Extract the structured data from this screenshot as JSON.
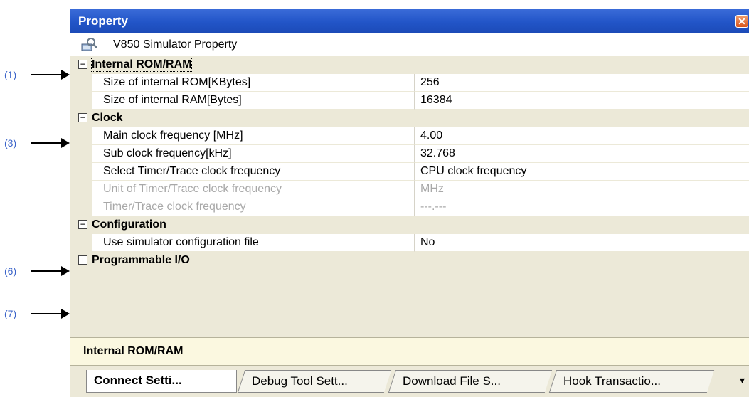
{
  "callouts": [
    "(1)",
    "(3)",
    "(6)",
    "(7)"
  ],
  "window": {
    "title": "Property",
    "close_icon": "close-icon"
  },
  "header": {
    "icon": "simulator-property-icon",
    "name": "V850 Simulator Property"
  },
  "grid": {
    "categories": [
      {
        "toggle": "−",
        "name": "Internal ROM/RAM"
      },
      {
        "toggle": "−",
        "name": "Clock"
      },
      {
        "toggle": "−",
        "name": "Configuration"
      },
      {
        "toggle": "+",
        "name": "Programmable I/O"
      }
    ],
    "rows": [
      {
        "key": "Size of internal ROM[KBytes]",
        "value": "256"
      },
      {
        "key": "Size of internal RAM[Bytes]",
        "value": "16384"
      },
      {
        "key": "Main clock frequency [MHz]",
        "value": "4.00"
      },
      {
        "key": "Sub clock frequency[kHz]",
        "value": "32.768"
      },
      {
        "key": "Select Timer/Trace clock frequency",
        "value": "CPU clock frequency"
      },
      {
        "key": "Unit of Timer/Trace clock frequency",
        "value": "MHz"
      },
      {
        "key": "Timer/Trace clock frequency",
        "value": "---.---"
      },
      {
        "key": "Use simulator configuration file",
        "value": "No"
      }
    ]
  },
  "description": "Internal ROM/RAM",
  "tabs": [
    "Connect Setti...",
    "Debug Tool Sett...",
    "Download File S...",
    "Hook Transactio..."
  ],
  "tab_overflow": "▾"
}
